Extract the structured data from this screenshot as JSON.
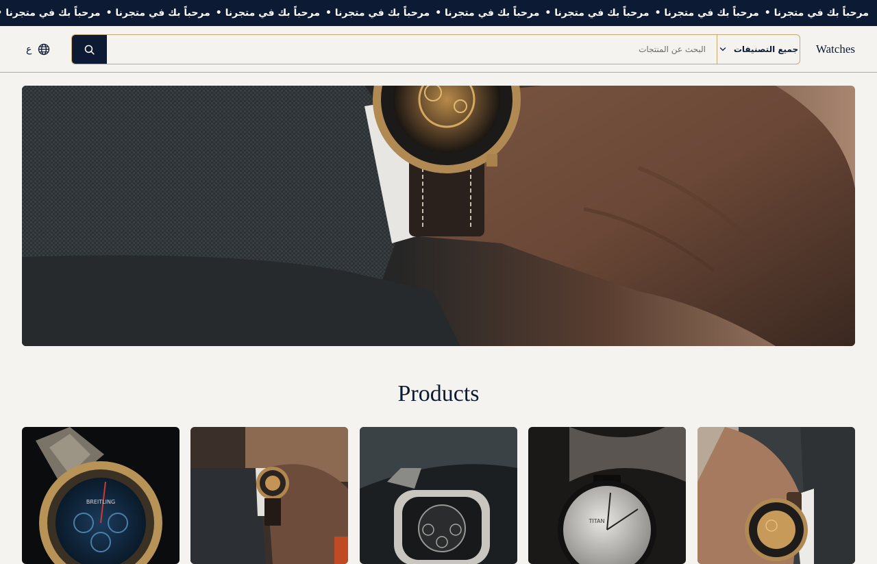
{
  "announcement": {
    "items": [
      "مرحباً بك في متجرنا •",
      "مرحباً بك في متجرنا •",
      "مرحباً بك في متجرنا •",
      "مرحباً بك في متجرنا •",
      "مرحباً بك في متجرنا •",
      "مرحباً بك في متجرنا •",
      "مرحباً بك في متجرنا •",
      "مرحباً بك في متجرنا •"
    ]
  },
  "header": {
    "brand": "Watches",
    "category_label": "جميع التصنيفات",
    "search_placeholder": "البحث عن المنتجات",
    "language_label": "ع"
  },
  "colors": {
    "navy": "#0c1a33",
    "gold": "#c9a86a",
    "background": "#f5f3ef"
  },
  "hero": {
    "image": "watch-on-wrist-photo"
  },
  "products": {
    "title": "Products",
    "items": [
      {
        "image": "breitling-chronograph-photo",
        "dial_text": "BREITLING"
      },
      {
        "image": "skeleton-watch-on-wrist-photo"
      },
      {
        "image": "tonneau-skeleton-watch-photo"
      },
      {
        "image": "titan-minimal-watch-photo",
        "dial_text": "TITAN"
      },
      {
        "image": "gold-skeleton-watch-on-wrist-photo"
      }
    ]
  }
}
